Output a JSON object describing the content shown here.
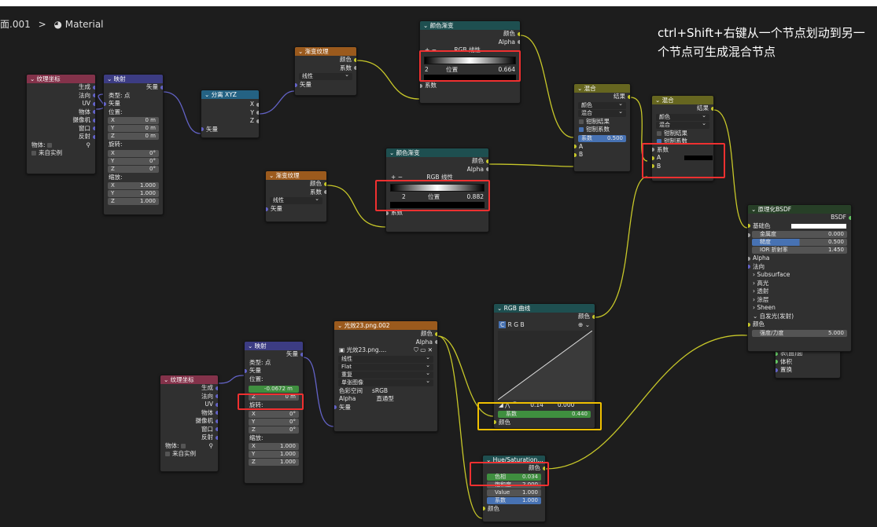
{
  "breadcrumb": {
    "part1": "面.001",
    "sep": ">",
    "material_icon": "material-sphere-icon",
    "part2": "Material"
  },
  "note": "ctrl+Shift+右键从一个节点划动到另一个节点可生成混合节点",
  "nodes": {
    "texcoord1": {
      "title": "纹理坐标",
      "outputs": [
        "生成",
        "法向",
        "UV",
        "物体",
        "摄像机",
        "窗口",
        "反射"
      ],
      "object_label": "物体:",
      "from_instancer": "来自实例"
    },
    "mapping1": {
      "title": "映射",
      "out": "矢量",
      "type_label": "类型:",
      "type_value": "点",
      "in_vector": "矢量",
      "loc": "位置:",
      "loc_x": "0 m",
      "loc_y": "0 m",
      "loc_z": "0 m",
      "rot": "旋转:",
      "rot_x": "0°",
      "rot_y": "0°",
      "rot_z": "0°",
      "scale": "缩放:",
      "sc_x": "1.000",
      "sc_y": "1.000",
      "sc_z": "1.000"
    },
    "sepxyz": {
      "title": "分离 XYZ",
      "x": "X",
      "y": "Y",
      "z": "Z",
      "in": "矢量"
    },
    "grad1": {
      "title": "渐变纹理",
      "color": "颜色",
      "fac": "系数",
      "type": "线性",
      "in": "矢量"
    },
    "ramp1": {
      "title": "颜色渐变",
      "color": "颜色",
      "alpha": "Alpha",
      "mode": "RGB",
      "interp": "线性",
      "idx": "2",
      "pos_label": "位置",
      "pos_value": "0.664",
      "in": "系数"
    },
    "grad2": {
      "title": "渐变纹理",
      "color": "颜色",
      "fac": "系数",
      "type": "线性",
      "in": "矢量"
    },
    "ramp2": {
      "title": "颜色渐变",
      "color": "颜色",
      "alpha": "Alpha",
      "mode": "RGB",
      "interp": "线性",
      "idx": "2",
      "pos_label": "位置",
      "pos_value": "0.882",
      "in": "系数"
    },
    "mix1": {
      "title": "混合",
      "result": "结果",
      "type": "颜色",
      "blend": "混合",
      "clamp_result": "钳制结果",
      "clamp_fac": "钳制系数",
      "fac_label": "系数",
      "fac_value": "0.500",
      "a": "A",
      "b": "B"
    },
    "mix2": {
      "title": "混合",
      "result": "结果",
      "type": "颜色",
      "blend": "混合",
      "clamp_result": "钳制结果",
      "clamp_fac": "钳制系数",
      "fac": "系数",
      "a": "A",
      "b": "B"
    },
    "bsdf": {
      "title": "原理化BSDF",
      "out": "BSDF",
      "base": "基础色",
      "metal": "金属度",
      "metal_v": "0.000",
      "rough": "糙度",
      "rough_v": "0.500",
      "ior": "IOR 折射率",
      "ior_v": "1.450",
      "alpha": "Alpha",
      "normal": "法向",
      "subs": "Subsurface",
      "spec": "高光",
      "trans": "透射",
      "coat": "涂层",
      "sheen": "Sheen",
      "emis": "自发光(发射)",
      "emis_color": "颜色",
      "strength": "强度/力度",
      "strength_v": "5.000"
    },
    "output": {
      "r1": "表(曲)面",
      "r2": "体积",
      "r3": "置换"
    },
    "curves": {
      "title": "RGB 曲线",
      "color": "颜色",
      "c": "C",
      "r": "R",
      "g": "G",
      "b": "B",
      "p1": "0.14",
      "p2": "0.000",
      "fac": "系数",
      "fac_v": "0.440",
      "in_color": "颜色"
    },
    "image": {
      "title": "光效23.png.002",
      "color": "颜色",
      "alpha": "Alpha",
      "file": "光效23.png....",
      "interp": "线性",
      "proj": "Flat",
      "ext": "重复",
      "src": "单张图像",
      "cs_label": "色彩空间",
      "cs_value": "sRGB",
      "alpha_label": "Alpha",
      "alpha_value": "直通型",
      "in": "矢量"
    },
    "texcoord2": {
      "title": "纹理坐标",
      "outputs": [
        "生成",
        "法向",
        "UV",
        "物体",
        "摄像机",
        "窗口",
        "反射"
      ],
      "object_label": "物体:",
      "from_instancer": "来自实例"
    },
    "mapping2": {
      "title": "映射",
      "out": "矢量",
      "type_label": "类型:",
      "type_value": "点",
      "in_vector": "矢量",
      "loc": "位置:",
      "loc_x": "-0.0672 m",
      "loc_y": "0 m",
      "loc_z": "0 m",
      "rot": "旋转:",
      "rot_x": "0°",
      "rot_y": "0°",
      "rot_z": "0°",
      "scale": "缩放:",
      "sc_x": "1.000",
      "sc_y": "1.000",
      "sc_z": "1.000"
    },
    "hsv": {
      "title": "Hue/Saturation...",
      "color": "颜色",
      "hue_label": "色相",
      "hue_v": "0.034",
      "sat_label": "饱和度",
      "sat_v": "2.000",
      "val_label": "Value",
      "val_v": "1.000",
      "fac_label": "系数",
      "fac_v": "1.000",
      "in_color": "颜色"
    }
  },
  "colors": {
    "wire": "#c7c729",
    "wire_vector": "#6363c7",
    "highlight_red": "#f03030",
    "highlight_yellow": "#f0c000"
  }
}
